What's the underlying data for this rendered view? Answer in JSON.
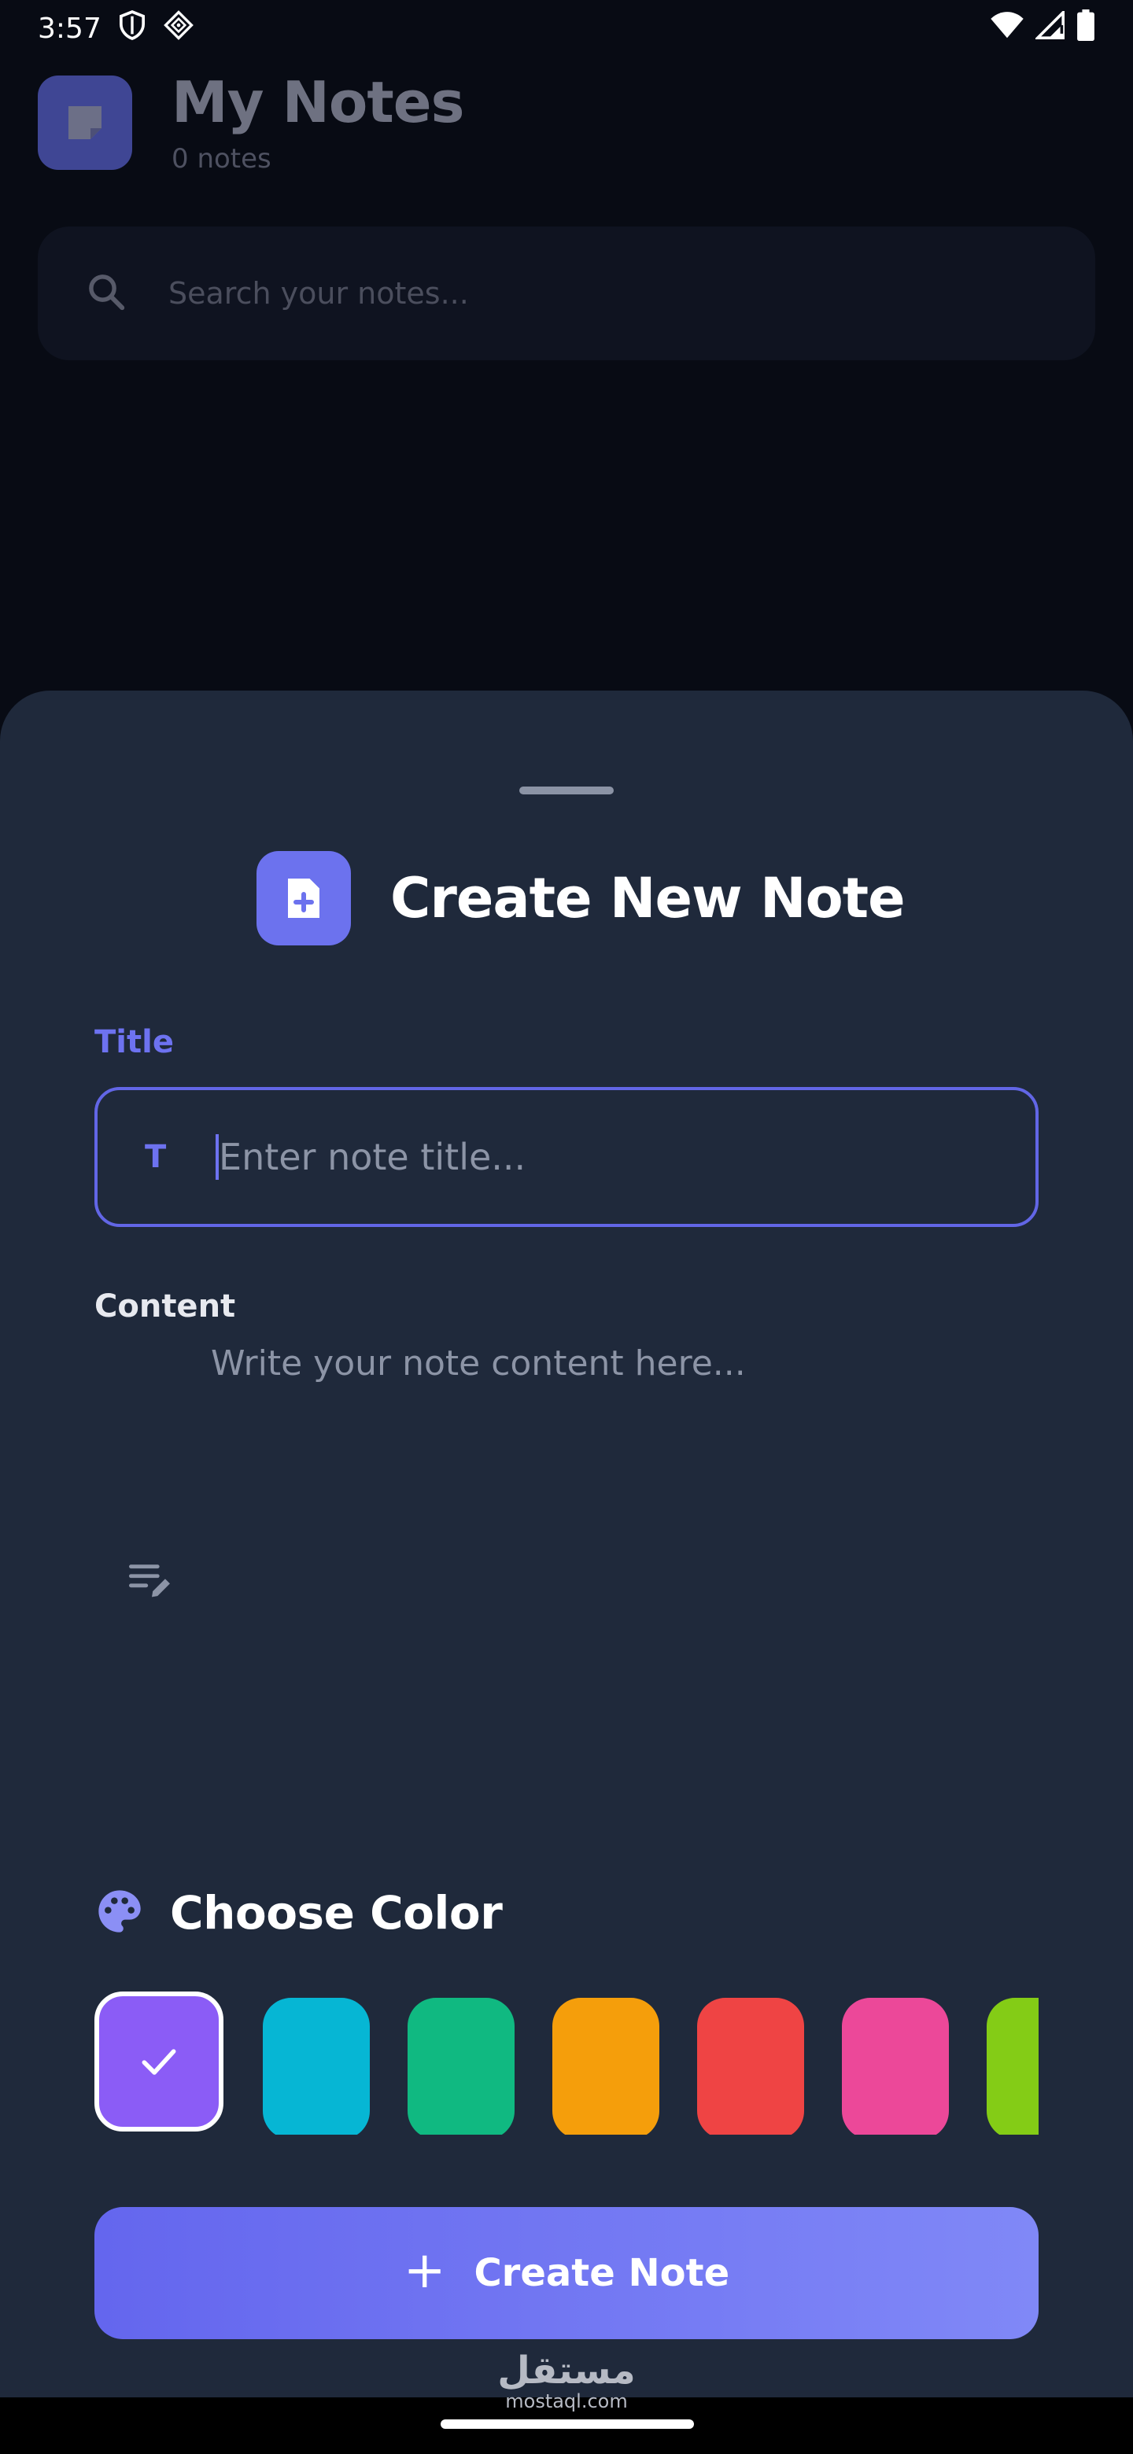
{
  "status_bar": {
    "time": "3:57",
    "left_icons": [
      "shield-icon",
      "app-notification-icon"
    ],
    "right_icons": [
      "wifi-icon",
      "cell-signal-icon",
      "battery-icon"
    ]
  },
  "app": {
    "title": "My Notes",
    "note_count": "0 notes",
    "logo_icon": "note-icon",
    "search": {
      "placeholder": "Search your notes...",
      "icon": "search-icon"
    }
  },
  "sheet": {
    "title": "Create New Note",
    "header_icon": "note-add-icon",
    "title_field": {
      "label": "Title",
      "icon_glyph": "T",
      "placeholder": "Enter note title...",
      "value": ""
    },
    "content_field": {
      "label": "Content",
      "placeholder": "Write your note content here...",
      "value": "",
      "icon": "notes-edit-icon"
    },
    "color_section": {
      "title": "Choose Color",
      "icon": "palette-icon",
      "selected_index": 0,
      "colors": [
        "#8b5cf6",
        "#06b6d4",
        "#10b981",
        "#f59e0b",
        "#ef4444",
        "#ec4899",
        "#84cc16"
      ]
    },
    "create_button": {
      "plus": "+",
      "label": "Create Note"
    }
  },
  "watermark": {
    "arabic": "مستقل",
    "latin": "mostaql.com"
  },
  "colors": {
    "accent": "#6d72f0",
    "sheet_background": "#1f293b",
    "app_background": "#080b14"
  }
}
